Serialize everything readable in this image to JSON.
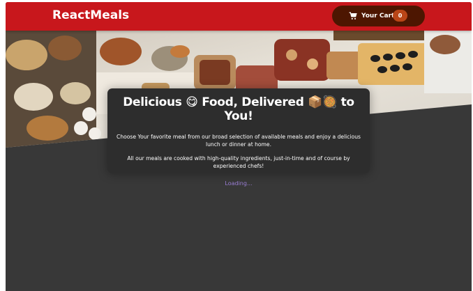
{
  "header": {
    "logo": "ReactMeals",
    "cart": {
      "label": "Your Cart",
      "count": "0"
    }
  },
  "summary": {
    "title": "Delicious 😋 Food, Delivered 📦🥘 to You!",
    "paragraph1": "Choose Your favorite meal from our broad selection of available meals and enjoy a delicious lunch or dinner at home.",
    "paragraph2": "All our meals are cooked with high-quality ingredients, just-in-time and of course by experienced chefs!"
  },
  "status": {
    "loading": "Loading..."
  },
  "colors": {
    "header": "#c8171c",
    "cart_button": "#4d1601",
    "cart_badge": "#b94517",
    "page_background": "#383838",
    "summary_card": "#2d2d2d",
    "loading_text": "#9b7fd6"
  }
}
